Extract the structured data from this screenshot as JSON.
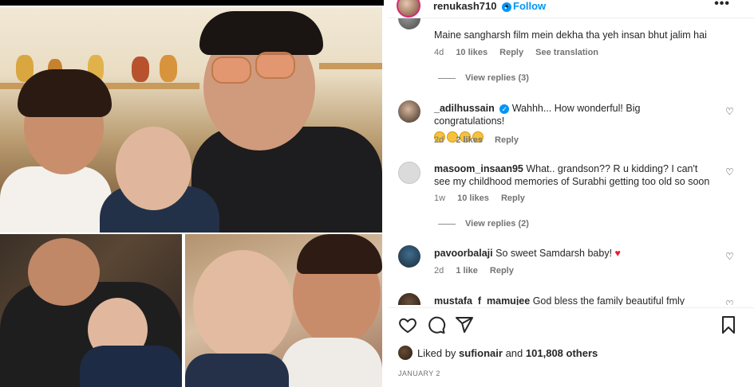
{
  "post": {
    "author": "renukash710",
    "dot": "•",
    "follow_label": "Follow",
    "more_label": "•••",
    "date": "JANUARY 2"
  },
  "comments": [
    {
      "user": "",
      "text": "Maine sangharsh film mein dekha tha yeh insan bhut jalim hai",
      "age": "4d",
      "likes": "10 likes",
      "reply": "Reply",
      "translate": "See translation",
      "view_replies": "View replies (3)"
    },
    {
      "user": "_adilhussain",
      "verified": true,
      "text": "Wahhh... How wonderful! Big congratulations!",
      "age": "2d",
      "likes": "2 likes",
      "reply": "Reply"
    },
    {
      "user": "masoom_insaan95",
      "text": "What.. grandson?? R u kidding? I can't see my childhood memories of Surabhi getting too old so soon",
      "age": "1w",
      "likes": "10 likes",
      "reply": "Reply",
      "view_replies": "View replies (2)"
    },
    {
      "user": "pavoorbalaji",
      "text": "So sweet Samdarsh baby!",
      "age": "2d",
      "likes": "1 like",
      "reply": "Reply"
    },
    {
      "user": "mustafa_f_mamujee",
      "text": "God bless the family beautiful fmly"
    }
  ],
  "likes_bar": {
    "prefix": "Liked by",
    "user": "sufionair",
    "middle": "and",
    "count": "101,808 others"
  },
  "icons": {
    "like": "heart-icon",
    "comment": "comment-icon",
    "share": "share-icon",
    "save": "bookmark-icon",
    "verified": "verified-badge-icon",
    "options": "more-options-icon"
  },
  "colors": {
    "link_blue": "#0095f6",
    "meta_gray": "#737373",
    "heart_red": "#ed1a3a",
    "story_ring": "#d62976"
  }
}
